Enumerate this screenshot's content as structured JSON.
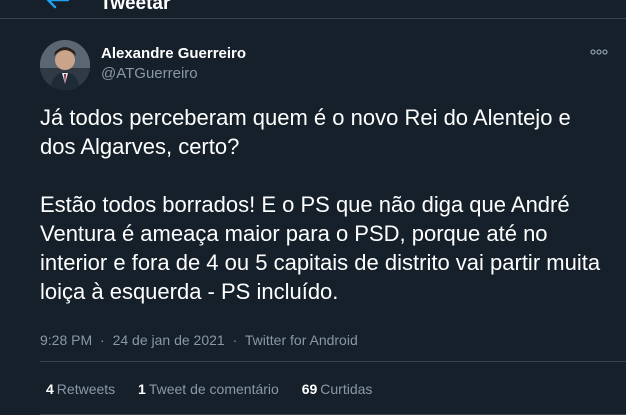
{
  "header": {
    "back_icon": "arrow-left-icon",
    "title": "Tweetar"
  },
  "author": {
    "name": "Alexandre Guerreiro",
    "handle": "@ATGuerreiro",
    "more_icon": "more-horizontal-icon"
  },
  "tweet": {
    "paragraph1": "Já todos perceberam quem é o novo Rei do Alentejo e dos Algarves, certo?",
    "paragraph2": "Estão todos borrados! E o PS que não diga que André Ventura é ameaça maior para o PSD, porque até no interior e fora de 4 ou 5 capitais de distrito vai partir muita loiça à esquerda - PS incluído."
  },
  "meta": {
    "time": "9:28 PM",
    "separator": "·",
    "date": "24 de jan de 2021",
    "source": "Twitter for Android"
  },
  "stats": {
    "retweets_count": "4",
    "retweets_label": "Retweets",
    "comments_count": "1",
    "comments_label": "Tweet de comentário",
    "likes_count": "69",
    "likes_label": "Curtidas"
  },
  "colors": {
    "background": "#15202b",
    "accent": "#1da1f2",
    "secondary_text": "#8899a6",
    "border": "#38444d"
  }
}
